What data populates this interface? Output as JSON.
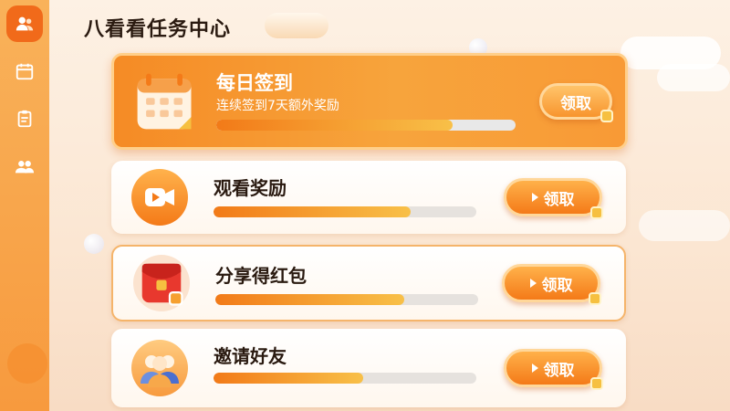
{
  "app": {
    "title": "八看看任务中心"
  },
  "sidebar": {
    "items": [
      {
        "icon": "users-icon",
        "active": true
      },
      {
        "icon": "calendar-icon",
        "active": false
      },
      {
        "icon": "clipboard-icon",
        "active": false
      },
      {
        "icon": "group-icon",
        "active": false
      }
    ]
  },
  "tasks": {
    "daily": {
      "title": "每日签到",
      "subtitle": "连续签到7天额外奖励",
      "progress": 0.79,
      "button": "领取",
      "icon": "calendar-icon"
    },
    "watch": {
      "title": "观看奖励",
      "progress": 0.75,
      "button": "领取",
      "icon": "video-camera-icon"
    },
    "share": {
      "title": "分享得红包",
      "progress": 0.72,
      "button": "领取",
      "icon": "red-envelope-icon"
    },
    "invite": {
      "title": "邀请好友",
      "progress": 0.57,
      "button": "领取",
      "icon": "friends-icon"
    }
  },
  "colors": {
    "accent": "#f58b25",
    "sidebar": "#f9b25a",
    "progress_start": "#f27a18",
    "progress_end": "#f8c048"
  }
}
